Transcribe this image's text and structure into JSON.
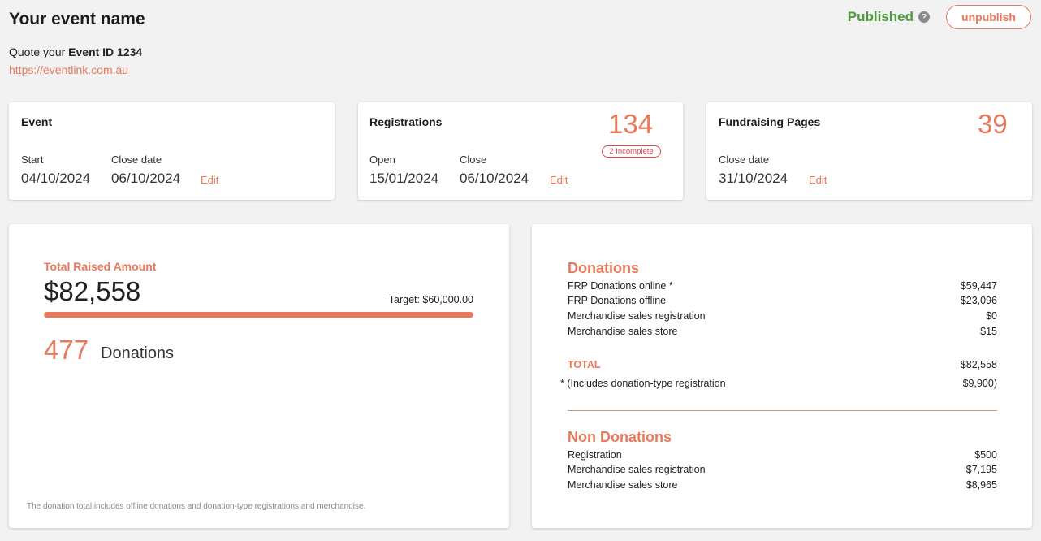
{
  "header": {
    "title": "Your event name",
    "quote_prefix": "Quote your ",
    "event_id_text": "Event ID 1234",
    "link": "https://eventlink.com.au",
    "status": "Published",
    "help_icon": "?",
    "unpublish_label": "unpublish"
  },
  "event_card": {
    "title": "Event",
    "start_label": "Start",
    "start_value": "04/10/2024",
    "close_label": "Close date",
    "close_value": "06/10/2024",
    "edit_label": "Edit"
  },
  "registrations_card": {
    "title": "Registrations",
    "count": "134",
    "incomplete_badge": "2 Incomplete",
    "open_label": "Open",
    "open_value": "15/01/2024",
    "close_label": "Close",
    "close_value": "06/10/2024",
    "edit_label": "Edit"
  },
  "fundraising_card": {
    "title": "Fundraising Pages",
    "count": "39",
    "close_label": "Close date",
    "close_value": "31/10/2024",
    "edit_label": "Edit"
  },
  "summary": {
    "total_label": "Total Raised Amount",
    "total_amount": "$82,558",
    "target_label": "Target: $60,000.00",
    "progress_fraction": 1.0,
    "donations_count": "477",
    "donations_word": "Donations",
    "footnote": "The donation total includes offline donations and donation-type registrations and merchandise."
  },
  "breakdown": {
    "donations_title": "Donations",
    "donations_rows": [
      {
        "label": "FRP Donations online *",
        "value": "$59,447"
      },
      {
        "label": "FRP Donations offline",
        "value": "$23,096"
      },
      {
        "label": "Merchandise sales registration",
        "value": "$0"
      },
      {
        "label": "Merchandise sales store",
        "value": "$15"
      }
    ],
    "total_label": "TOTAL",
    "total_value": "$82,558",
    "note_label": "* (Includes donation-type registration",
    "note_value": "$9,900)",
    "non_donations_title": "Non Donations",
    "non_donations_rows": [
      {
        "label": "Registration",
        "value": "$500"
      },
      {
        "label": "Merchandise sales registration",
        "value": "$7,195"
      },
      {
        "label": "Merchandise sales store",
        "value": "$8,965"
      }
    ]
  },
  "colors": {
    "accent": "#e8795b",
    "published": "#4d9a3a",
    "badge": "#dd4444"
  }
}
